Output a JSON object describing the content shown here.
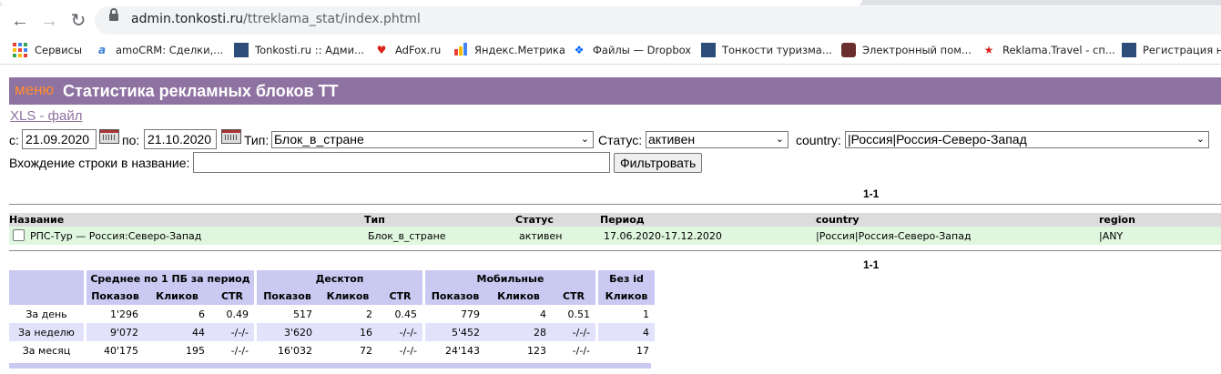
{
  "browser": {
    "url_host": "admin.tonkosti.ru",
    "url_path": "/ttreklama_stat/index.phtml"
  },
  "bookmarks": [
    {
      "label": "Сервисы",
      "icon": "apps-icon"
    },
    {
      "label": "amoCRM: Сделки,...",
      "icon": "amocrm-icon"
    },
    {
      "label": "Tonkosti.ru :: Адми...",
      "icon": "tonkosti-icon"
    },
    {
      "label": "AdFox.ru",
      "icon": "adfox-icon"
    },
    {
      "label": "Яндекс.Метрика",
      "icon": "metrika-icon"
    },
    {
      "label": "Файлы — Dropbox",
      "icon": "dropbox-icon"
    },
    {
      "label": "Тонкости туризма...",
      "icon": "tonkosti-icon"
    },
    {
      "label": "Электронный пом...",
      "icon": "briefcase-icon"
    },
    {
      "label": "Reklama.Travel - сп...",
      "icon": "star-icon"
    },
    {
      "label": "Регистрация но",
      "icon": "tonkosti-icon"
    }
  ],
  "header": {
    "menu": "меню",
    "title": "Статистика рекламных блоков ТТ"
  },
  "xls_link": "XLS - файл",
  "filters": {
    "from_label": "с:",
    "from_value": "21.09.2020",
    "to_label": "по:",
    "to_value": "21.10.2020",
    "type_label": "Тип:",
    "type_value": "Блок_в_стране",
    "status_label": "Статус:",
    "status_value": "активен",
    "country_label": "country:",
    "country_value": "|Россия|Россия-Северо-Запад",
    "name_label": "Вхождение строки в название:",
    "name_value": "",
    "filter_button": "Фильтровать"
  },
  "pager": "1-1",
  "results": {
    "headers": [
      "Название",
      "Тип",
      "Статус",
      "Период",
      "country",
      "region"
    ],
    "row": {
      "name": "РПС-Тур — Россия:Северо-Запад",
      "type": "Блок_в_стране",
      "status": "активен",
      "period": "17.06.2020-17.12.2020",
      "country": "|Россия|Россия-Северо-Запад",
      "region": "|ANY"
    }
  },
  "stats": {
    "groups": [
      "Среднее по 1 ПБ за период",
      "Десктоп",
      "Мобильные",
      "Без id"
    ],
    "sub": [
      "Показов",
      "Кликов",
      "CTR"
    ],
    "sub_noid": "Кликов",
    "rows": [
      {
        "label": "За день",
        "cells": [
          "1'296",
          "6",
          "0.49",
          "517",
          "2",
          "0.45",
          "779",
          "4",
          "0.51",
          "1"
        ]
      },
      {
        "label": "За неделю",
        "cells": [
          "9'072",
          "44",
          "-/-/-",
          "3'620",
          "16",
          "-/-/-",
          "5'452",
          "28",
          "-/-/-",
          "4"
        ]
      },
      {
        "label": "За месяц",
        "cells": [
          "40'175",
          "195",
          "-/-/-",
          "16'032",
          "72",
          "-/-/-",
          "24'143",
          "123",
          "-/-/-",
          "17"
        ]
      }
    ]
  }
}
